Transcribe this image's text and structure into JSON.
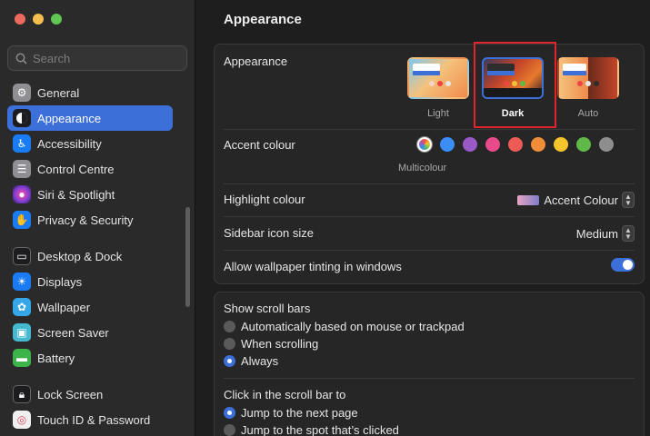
{
  "window": {
    "traffic_lights": [
      "close",
      "minimize",
      "zoom"
    ]
  },
  "search": {
    "placeholder": "Search"
  },
  "sidebar": {
    "items": [
      {
        "label": "General",
        "icon": "gear-icon",
        "color": "#8e8e93"
      },
      {
        "label": "Appearance",
        "icon": "appearance-icon",
        "color": "#1c1c1e",
        "active": true
      },
      {
        "label": "Accessibility",
        "icon": "accessibility-icon",
        "color": "#1a7cf5"
      },
      {
        "label": "Control Centre",
        "icon": "control-centre-icon",
        "color": "#8e8e93"
      },
      {
        "label": "Siri & Spotlight",
        "icon": "siri-icon",
        "color": "#b03bd4"
      },
      {
        "label": "Privacy & Security",
        "icon": "hand-icon",
        "color": "#1a7cf5"
      },
      {
        "label": "Desktop & Dock",
        "icon": "dock-icon",
        "color": "#1c1c1e"
      },
      {
        "label": "Displays",
        "icon": "displays-icon",
        "color": "#1a7cf5"
      },
      {
        "label": "Wallpaper",
        "icon": "wallpaper-icon",
        "color": "#35a7e8"
      },
      {
        "label": "Screen Saver",
        "icon": "screen-saver-icon",
        "color": "#45b9d0"
      },
      {
        "label": "Battery",
        "icon": "battery-icon",
        "color": "#3cb44a"
      },
      {
        "label": "Lock Screen",
        "icon": "lock-icon",
        "color": "#1c1c1e"
      },
      {
        "label": "Touch ID & Password",
        "icon": "fingerprint-icon",
        "color": "#e8e8e8"
      }
    ]
  },
  "main": {
    "title": "Appearance",
    "appearance": {
      "label": "Appearance",
      "options": [
        {
          "label": "Light",
          "selected": false
        },
        {
          "label": "Dark",
          "selected": true
        },
        {
          "label": "Auto",
          "selected": false
        }
      ]
    },
    "accent": {
      "label": "Accent colour",
      "selected_label": "Multicolour",
      "colors": [
        "multicolour",
        "#3a8ef6",
        "#9b59c8",
        "#e94a8a",
        "#ec5b55",
        "#ef8d3a",
        "#f5c32c",
        "#5fb848",
        "#8e8e8e"
      ]
    },
    "highlight": {
      "label": "Highlight colour",
      "value": "Accent Colour"
    },
    "sidebar_icon_size": {
      "label": "Sidebar icon size",
      "value": "Medium"
    },
    "wallpaper_tinting": {
      "label": "Allow wallpaper tinting in windows",
      "enabled": true
    },
    "scroll_bars": {
      "label": "Show scroll bars",
      "options": [
        {
          "label": "Automatically based on mouse or trackpad",
          "selected": false
        },
        {
          "label": "When scrolling",
          "selected": false
        },
        {
          "label": "Always",
          "selected": true
        }
      ]
    },
    "scroll_click": {
      "label": "Click in the scroll bar to",
      "options": [
        {
          "label": "Jump to the next page",
          "selected": true
        },
        {
          "label": "Jump to the spot that’s clicked",
          "selected": false
        }
      ]
    }
  }
}
